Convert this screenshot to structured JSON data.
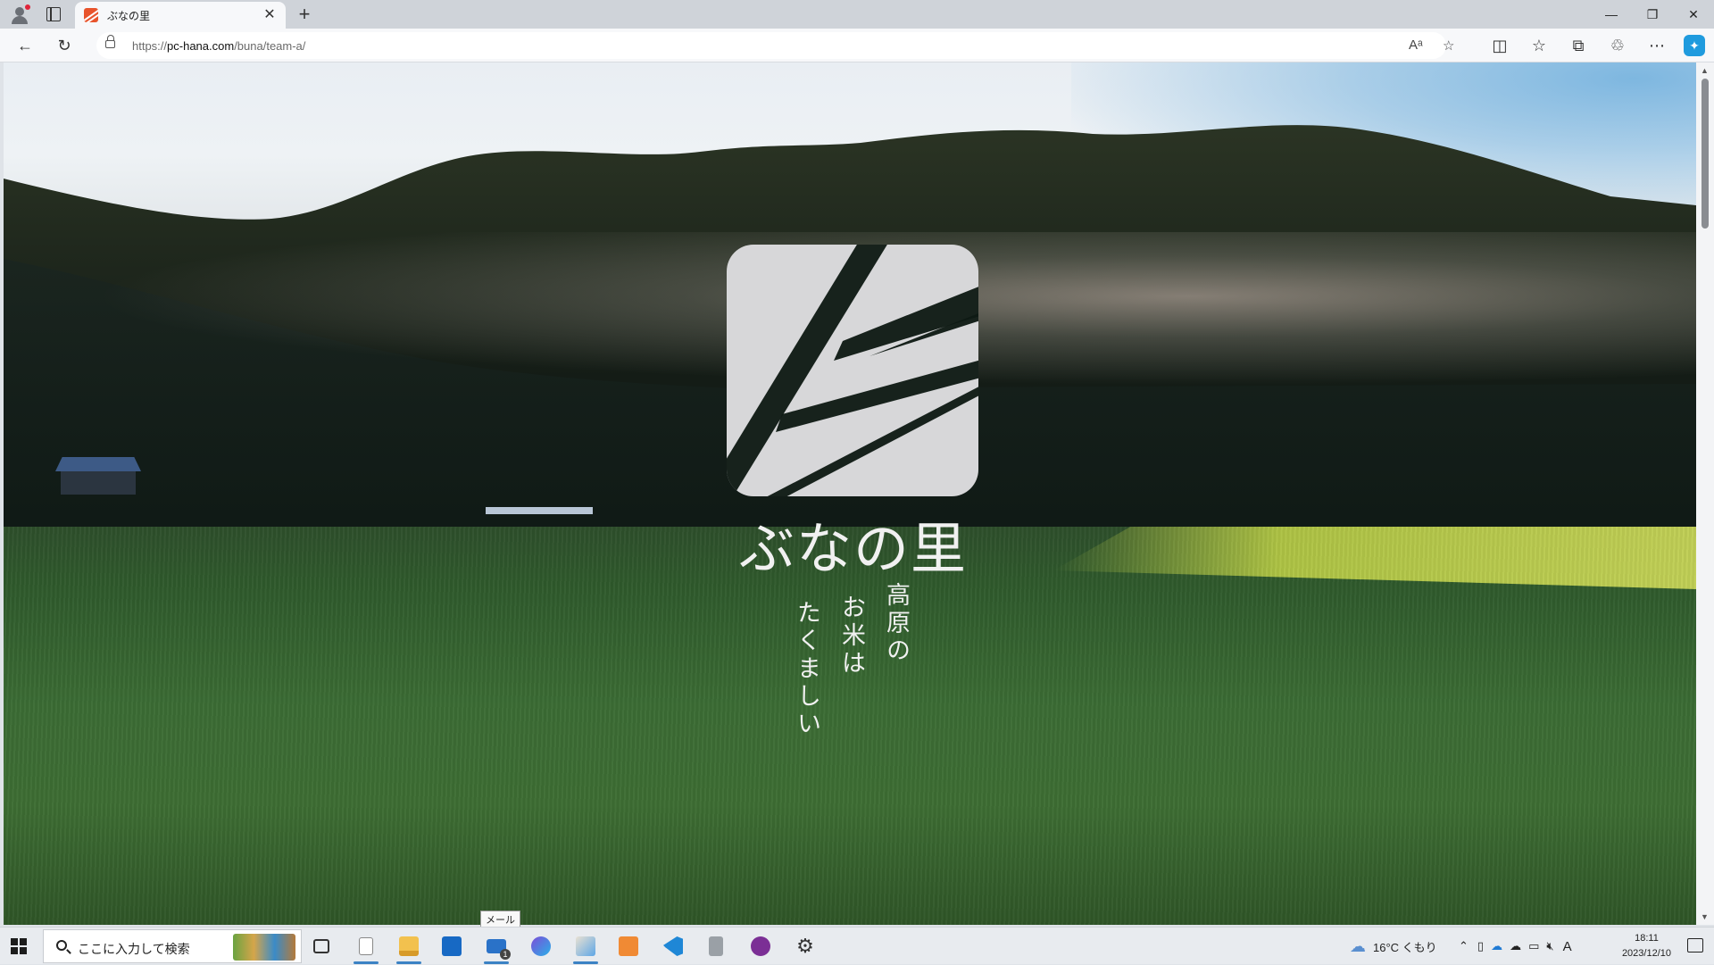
{
  "browser": {
    "tab_title": "ぶなの里",
    "url_prefix": "https://",
    "url_host": "pc-hana.com",
    "url_path": "/buna/team-a/"
  },
  "page": {
    "brand_name": "ぶなの里",
    "tagline_col1": "高原の",
    "tagline_col2": "お米は",
    "tagline_col3": "たくましい"
  },
  "tooltip": "メール",
  "taskbar": {
    "search_placeholder": "ここに入力して検索",
    "weather": "16°C くもり",
    "time": "18:11",
    "date": "2023/12/10",
    "ime": "A",
    "mail_badge": "1"
  },
  "colors": {
    "accent": "#3b82c4",
    "favicon": "#e8542c",
    "edge_copilot": "#1f9bde"
  }
}
